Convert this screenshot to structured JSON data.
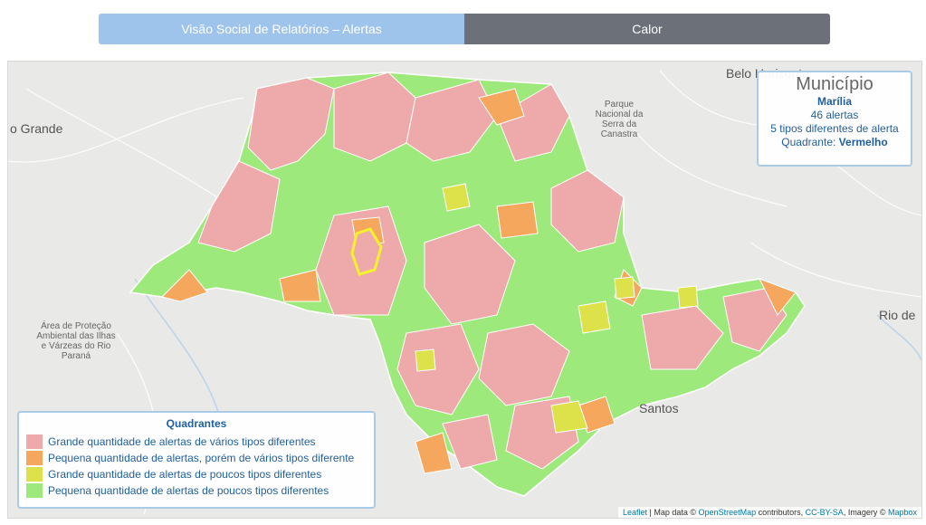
{
  "tabs": [
    {
      "label": "Visão Social de Relatórios – Alertas"
    },
    {
      "label": "Calor"
    }
  ],
  "basemap_labels": {
    "belo_horizonte": "Belo Horizonte",
    "campo_grande": "o Grande",
    "parque": "Parque Nacional da Serra da Canastra",
    "area_protecao": "Área de Proteção Ambiental das Ilhas e Várzeas do Rio Paraná",
    "rio": "Rio de",
    "santos": "Santos"
  },
  "info": {
    "title": "Município",
    "city": "Marília",
    "alerts": "46 alertas",
    "types": "5 tipos diferentes de alerta",
    "quadrant_label": "Quadrante:",
    "quadrant_value": "Vermelho"
  },
  "legend": {
    "title": "Quadrantes",
    "items": [
      {
        "label": "Grande quantidade de alertas de vários tipos diferentes",
        "color": "#eeaaaa"
      },
      {
        "label": "Pequena quantidade de alertas, porém de vários tipos diferente",
        "color": "#f5a75e"
      },
      {
        "label": "Grande quantidade de alertas de poucos tipos diferentes",
        "color": "#dde24a"
      },
      {
        "label": "Pequena quantidade de alertas de poucos tipos diferentes",
        "color": "#9ee97b"
      }
    ]
  },
  "attribution": {
    "leaflet": "Leaflet",
    "sep1": " | Map data © ",
    "osm": "OpenStreetMap",
    "sep2": " contributors, ",
    "license": "CC-BY-SA",
    "sep3": ", Imagery © ",
    "mapbox": "Mapbox"
  }
}
